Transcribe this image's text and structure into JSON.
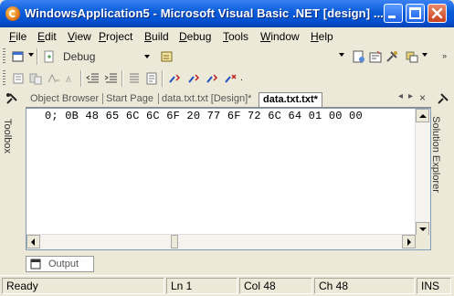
{
  "window": {
    "title": "WindowsApplication5 - Microsoft Visual Basic .NET [design] ...",
    "icon": "vb-app-icon"
  },
  "menu": [
    {
      "label": "File",
      "mnemonic": "F"
    },
    {
      "label": "Edit",
      "mnemonic": "E"
    },
    {
      "label": "View",
      "mnemonic": "V"
    },
    {
      "label": "Project",
      "mnemonic": "P"
    },
    {
      "label": "Build",
      "mnemonic": "B"
    },
    {
      "label": "Debug",
      "mnemonic": "D"
    },
    {
      "label": "Tools",
      "mnemonic": "T"
    },
    {
      "label": "Window",
      "mnemonic": "W"
    },
    {
      "label": "Help",
      "mnemonic": "H"
    }
  ],
  "toolbar": {
    "config_value": "Debug"
  },
  "side": {
    "left_label": "Toolbox",
    "right_label": "Solution Explorer"
  },
  "tabs": [
    {
      "label": "Object Browser",
      "active": false
    },
    {
      "label": "Start Page",
      "active": false
    },
    {
      "label": "data.txt.txt [Design]*",
      "active": false
    },
    {
      "label": "data.txt.txt*",
      "active": true
    }
  ],
  "editor": {
    "line": "0; 0B 48 65 6C 6C 6F 20 77 6F 72 6C 64 01 00 00"
  },
  "output_tab": {
    "label": "Output"
  },
  "status": {
    "ready": "Ready",
    "line": "Ln 1",
    "col": "Col 48",
    "ch": "Ch 48",
    "mode": "INS"
  },
  "colors": {
    "titlebar": "#0a5bd8",
    "chrome": "#ece9d8",
    "editor_bg": "#ffffff"
  }
}
